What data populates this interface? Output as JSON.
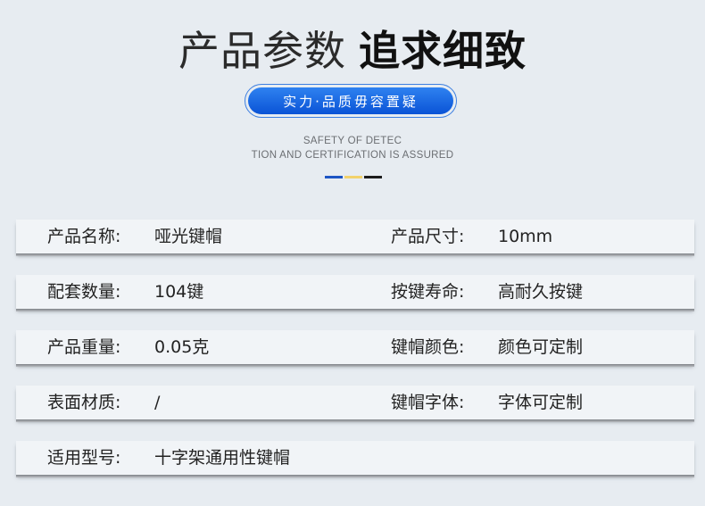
{
  "header": {
    "title_light": "产品参数",
    "title_bold": "追求细致",
    "pill_text": "实力·品质毋容置疑",
    "subtitle_line1": "SAFETY OF DETEC",
    "subtitle_line2": "TION AND CERTIFICATION IS ASSURED"
  },
  "accent_colors": [
    "#1d55c4",
    "#f2d26b",
    "#1c1c1c"
  ],
  "specs": [
    {
      "label1": "产品名称:",
      "value1": "哑光键帽",
      "label2": "产品尺寸:",
      "value2": "10mm"
    },
    {
      "label1": "配套数量:",
      "value1": "104键",
      "label2": "按键寿命:",
      "value2": "高耐久按键"
    },
    {
      "label1": "产品重量:",
      "value1": "0.05克",
      "label2": "键帽颜色:",
      "value2": "颜色可定制"
    },
    {
      "label1": "表面材质:",
      "value1": "/",
      "label2": "键帽字体:",
      "value2": "字体可定制"
    },
    {
      "label1": "适用型号:",
      "value1": "十字架通用性键帽",
      "label2": "",
      "value2": ""
    }
  ]
}
